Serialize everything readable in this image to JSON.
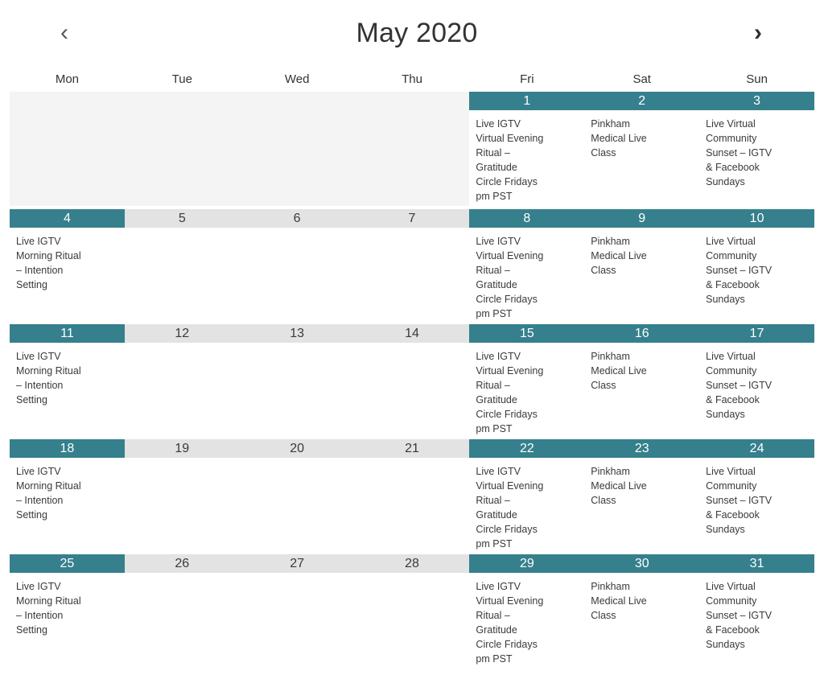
{
  "header": {
    "title": "May 2020",
    "prev_label": "‹",
    "next_label": "›",
    "prev_icon": "chevron-left-icon",
    "next_icon": "chevron-right-icon"
  },
  "weekdays": [
    "Mon",
    "Tue",
    "Wed",
    "Thu",
    "Fri",
    "Sat",
    "Sun"
  ],
  "colors": {
    "accent_teal": "#35808c",
    "inactive_header_gray": "#e3e3e3",
    "empty_cell_gray": "#f4f4f4",
    "text_dark": "#333333",
    "event_text": "#3a3a3a"
  },
  "events": {
    "monday": "Live IGTV Morning Ritual – Intention Setting",
    "friday": "Live IGTV Virtual Evening Ritual – Gratitude Circle Fridays pm PST",
    "saturday": "Pinkham Medical Live Class",
    "sunday": "Live Virtual Community Sunset – IGTV & Facebook Sundays"
  },
  "weeks": [
    {
      "days": [
        {
          "num": "",
          "state": "empty",
          "events": ""
        },
        {
          "num": "",
          "state": "empty",
          "events": ""
        },
        {
          "num": "",
          "state": "empty",
          "events": ""
        },
        {
          "num": "",
          "state": "empty",
          "events": ""
        },
        {
          "num": "1",
          "state": "active",
          "events": "Live IGTV\nVirtual Evening\nRitual –\nGratitude\nCircle Fridays\npm PST"
        },
        {
          "num": "2",
          "state": "active",
          "events": "Pinkham\nMedical Live\nClass"
        },
        {
          "num": "3",
          "state": "active",
          "events": "Live Virtual\nCommunity\nSunset – IGTV\n& Facebook\nSundays"
        }
      ]
    },
    {
      "days": [
        {
          "num": "4",
          "state": "active",
          "events": "Live IGTV\nMorning Ritual\n– Intention\nSetting"
        },
        {
          "num": "5",
          "state": "inactive",
          "events": ""
        },
        {
          "num": "6",
          "state": "inactive",
          "events": ""
        },
        {
          "num": "7",
          "state": "inactive",
          "events": ""
        },
        {
          "num": "8",
          "state": "active",
          "events": "Live IGTV\nVirtual Evening\nRitual –\nGratitude\nCircle Fridays\npm PST"
        },
        {
          "num": "9",
          "state": "active",
          "events": "Pinkham\nMedical Live\nClass"
        },
        {
          "num": "10",
          "state": "active",
          "events": "Live Virtual\nCommunity\nSunset – IGTV\n& Facebook\nSundays"
        }
      ]
    },
    {
      "days": [
        {
          "num": "11",
          "state": "active",
          "events": "Live IGTV\nMorning Ritual\n– Intention\nSetting"
        },
        {
          "num": "12",
          "state": "inactive",
          "events": ""
        },
        {
          "num": "13",
          "state": "inactive",
          "events": ""
        },
        {
          "num": "14",
          "state": "inactive",
          "events": ""
        },
        {
          "num": "15",
          "state": "active",
          "events": "Live IGTV\nVirtual Evening\nRitual –\nGratitude\nCircle Fridays\npm PST"
        },
        {
          "num": "16",
          "state": "active",
          "events": "Pinkham\nMedical Live\nClass"
        },
        {
          "num": "17",
          "state": "active",
          "events": "Live Virtual\nCommunity\nSunset – IGTV\n& Facebook\nSundays"
        }
      ]
    },
    {
      "days": [
        {
          "num": "18",
          "state": "active",
          "events": "Live IGTV\nMorning Ritual\n– Intention\nSetting"
        },
        {
          "num": "19",
          "state": "inactive",
          "events": ""
        },
        {
          "num": "20",
          "state": "inactive",
          "events": ""
        },
        {
          "num": "21",
          "state": "inactive",
          "events": ""
        },
        {
          "num": "22",
          "state": "active",
          "events": "Live IGTV\nVirtual Evening\nRitual –\nGratitude\nCircle Fridays\npm PST"
        },
        {
          "num": "23",
          "state": "active",
          "events": "Pinkham\nMedical Live\nClass"
        },
        {
          "num": "24",
          "state": "active",
          "events": "Live Virtual\nCommunity\nSunset – IGTV\n& Facebook\nSundays"
        }
      ]
    },
    {
      "days": [
        {
          "num": "25",
          "state": "active",
          "events": "Live IGTV\nMorning Ritual\n– Intention\nSetting"
        },
        {
          "num": "26",
          "state": "inactive",
          "events": ""
        },
        {
          "num": "27",
          "state": "inactive",
          "events": ""
        },
        {
          "num": "28",
          "state": "inactive",
          "events": ""
        },
        {
          "num": "29",
          "state": "active",
          "events": "Live IGTV\nVirtual Evening\nRitual –\nGratitude\nCircle Fridays\npm PST"
        },
        {
          "num": "30",
          "state": "active",
          "events": "Pinkham\nMedical Live\nClass"
        },
        {
          "num": "31",
          "state": "active",
          "events": "Live Virtual\nCommunity\nSunset – IGTV\n& Facebook\nSundays"
        }
      ]
    }
  ]
}
